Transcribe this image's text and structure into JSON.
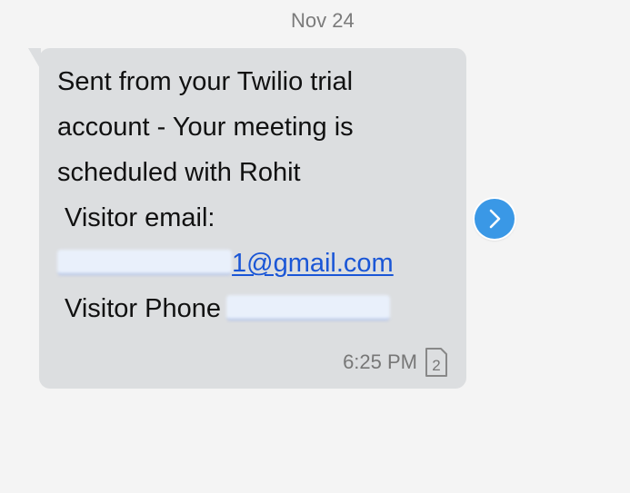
{
  "conversation": {
    "date_header": "Nov 24"
  },
  "message": {
    "line1": "Sent from your Twilio trial",
    "line2": "account - Your meeting is",
    "line3": "scheduled with Rohit",
    "line4": "Visitor email:",
    "email_suffix": "1@gmail.com",
    "phone_label": "Visitor Phone",
    "time": "6:25 PM",
    "sim_slot": "2"
  },
  "icons": {
    "sim": "sim-card-icon",
    "forward": "forward-arrow-icon"
  },
  "colors": {
    "bubble": "#dcdee0",
    "link": "#1a56d6",
    "forward_button": "#3a98e6"
  }
}
